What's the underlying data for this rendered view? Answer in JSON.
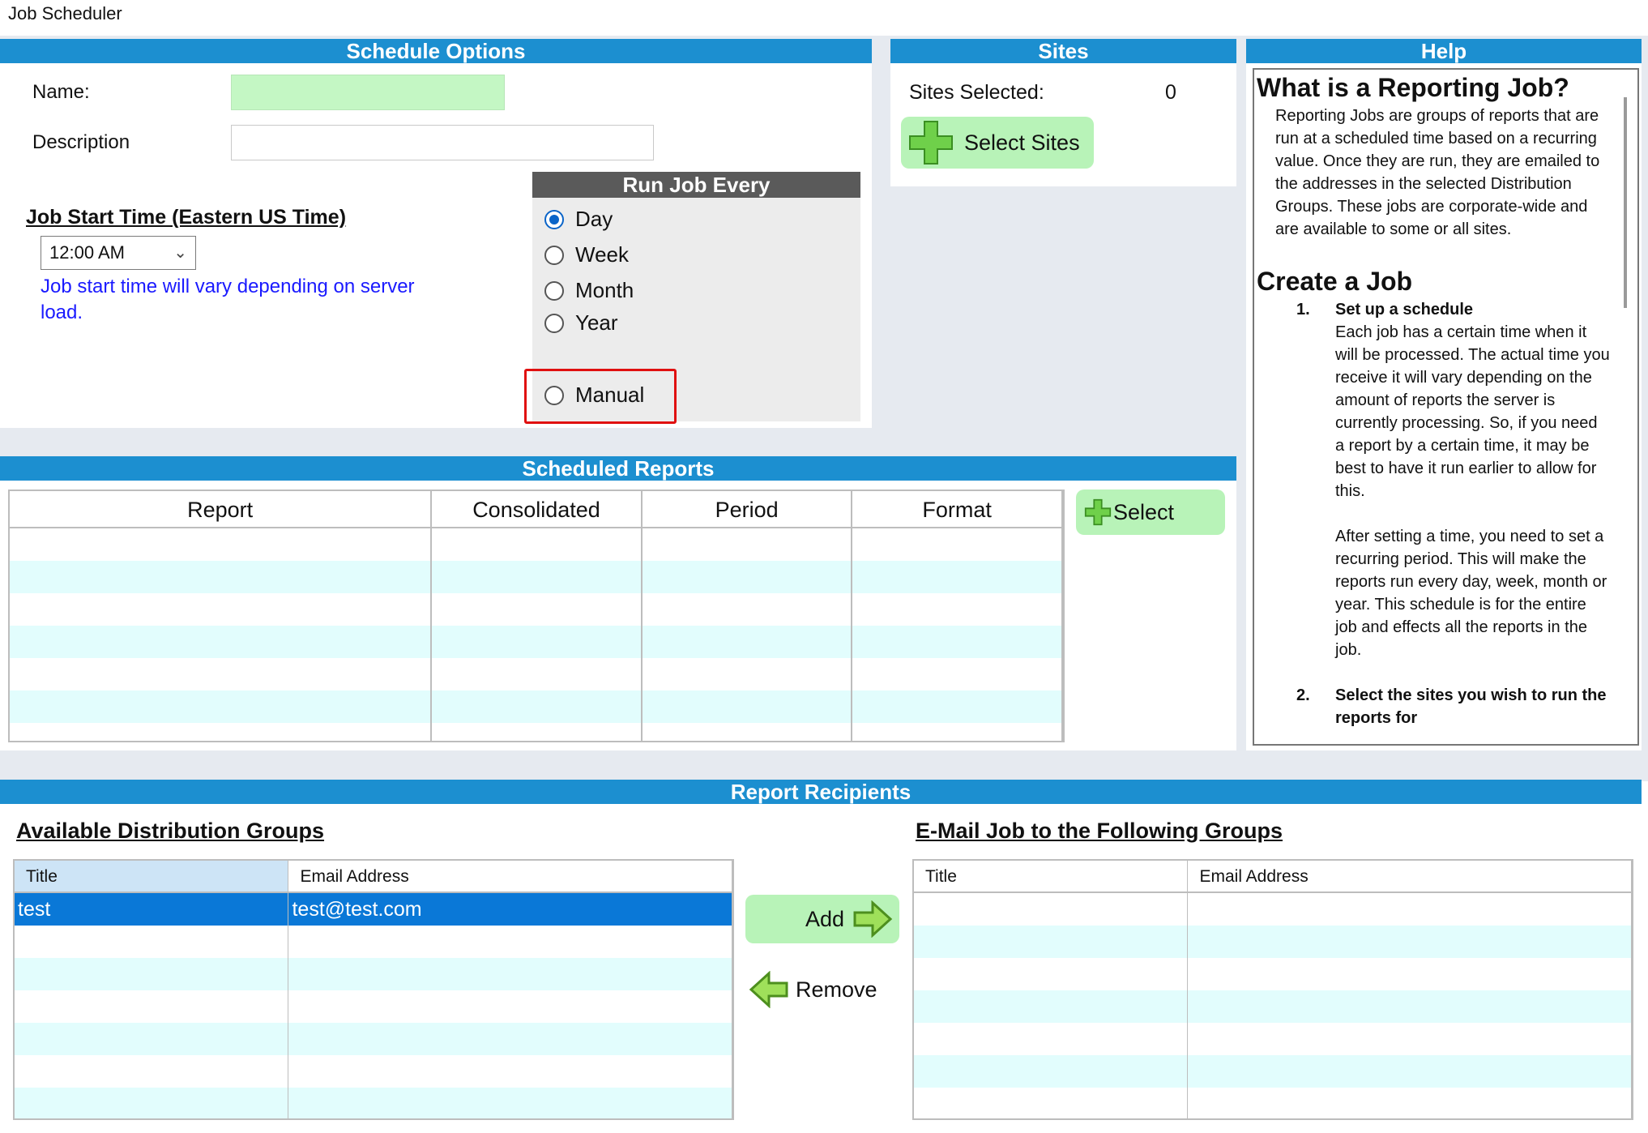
{
  "window": {
    "title": "Job Scheduler"
  },
  "schedule_options": {
    "header": "Schedule Options",
    "name_label": "Name:",
    "name_value": "",
    "description_label": "Description",
    "description_value": "",
    "start_time_title": "Job Start Time (Eastern US Time)",
    "start_time_value": "12:00 AM",
    "start_time_note": "Job start time will vary depending on server load.",
    "run_every": {
      "header": "Run Job Every",
      "options": [
        "Day",
        "Week",
        "Month",
        "Year"
      ],
      "selected": "Day",
      "manual_label": "Manual"
    }
  },
  "sites": {
    "header": "Sites",
    "selected_label": "Sites Selected:",
    "selected_count": "0",
    "select_button": "Select Sites"
  },
  "help": {
    "header": "Help",
    "q1_title": "What is a Reporting Job?",
    "q1_text": "Reporting Jobs are groups of reports that are run at a scheduled time based on a recurring value.  Once they are run, they are emailed to the addresses in the selected Distribution Groups.  These jobs are corporate-wide and are available to some or all sites.",
    "q2_title": "Create a Job",
    "step1_num": "1.",
    "step1_title": "Set up a schedule",
    "step1_text": "Each job has a certain time when it will be processed.  The actual time you receive it will vary depending on the amount of reports the server is currently processing.  So, if you need a report by a certain time, it may be best to have it run earlier to allow for this.",
    "step1_text2": "After setting a time, you need to set a recurring period.  This will make the reports run every day, week, month or year.  This schedule is for the entire job and effects all the reports in the job.",
    "step2_num": "2.",
    "step2_title": "Select the sites you wish to run the reports for"
  },
  "scheduled_reports": {
    "header": "Scheduled Reports",
    "columns": [
      "Report",
      "Consolidated",
      "Period",
      "Format"
    ],
    "select_button": "Select"
  },
  "recipients": {
    "header": "Report Recipients",
    "available_title": "Available Distribution Groups",
    "email_title": "E-Mail Job to the Following Groups",
    "col_title": "Title",
    "col_email": "Email Address",
    "available_rows": [
      {
        "title": "test",
        "email": "test@test.com"
      }
    ],
    "add_button": "Add",
    "remove_button": "Remove"
  }
}
